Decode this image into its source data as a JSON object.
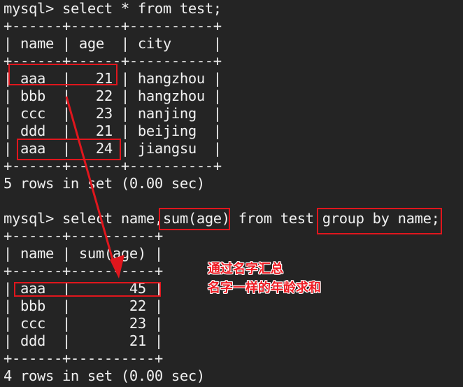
{
  "terminal": {
    "query1": {
      "prompt": "mysql> ",
      "command": "select * from test;",
      "border": "+------+------+----------+",
      "header_line": "| name | age  | city     |",
      "columns": [
        "name",
        "age",
        "city"
      ],
      "rows": [
        {
          "name": "aaa",
          "age": "21",
          "city": "hangzhou",
          "line": "| aaa  |   21 | hangzhou |"
        },
        {
          "name": "bbb",
          "age": "22",
          "city": "hangzhou",
          "line": "| bbb  |   22 | hangzhou |"
        },
        {
          "name": "ccc",
          "age": "23",
          "city": "nanjing",
          "line": "| ccc  |   23 | nanjing  |"
        },
        {
          "name": "ddd",
          "age": "21",
          "city": "beijing",
          "line": "| ddd  |   21 | beijing  |"
        },
        {
          "name": "aaa",
          "age": "24",
          "city": "jiangsu",
          "line": "| aaa  |   24 | jiangsu  |"
        }
      ],
      "status": "5 rows in set (0.00 sec)"
    },
    "query2": {
      "prompt": "mysql> ",
      "command": "select name,sum(age) from test group by name;",
      "border": "+------+----------+",
      "header_line": "| name | sum(age) |",
      "columns": [
        "name",
        "sum(age)"
      ],
      "rows": [
        {
          "name": "aaa",
          "sum_age": "45",
          "line": "| aaa  |       45 |"
        },
        {
          "name": "bbb",
          "sum_age": "22",
          "line": "| bbb  |       22 |"
        },
        {
          "name": "ccc",
          "sum_age": "23",
          "line": "| ccc  |       23 |"
        },
        {
          "name": "ddd",
          "sum_age": "21",
          "line": "| ddd  |       21 |"
        }
      ],
      "status": "4 rows in set (0.00 sec)"
    }
  },
  "annotations": {
    "line1": "通过名字汇总",
    "line2": "名字一样的年龄求和"
  },
  "colors": {
    "background": "#242424",
    "text": "#f0f0f0",
    "highlight": "#e0161d",
    "annotation_fill": "#ee1c24",
    "annotation_outline": "#ffffff"
  }
}
